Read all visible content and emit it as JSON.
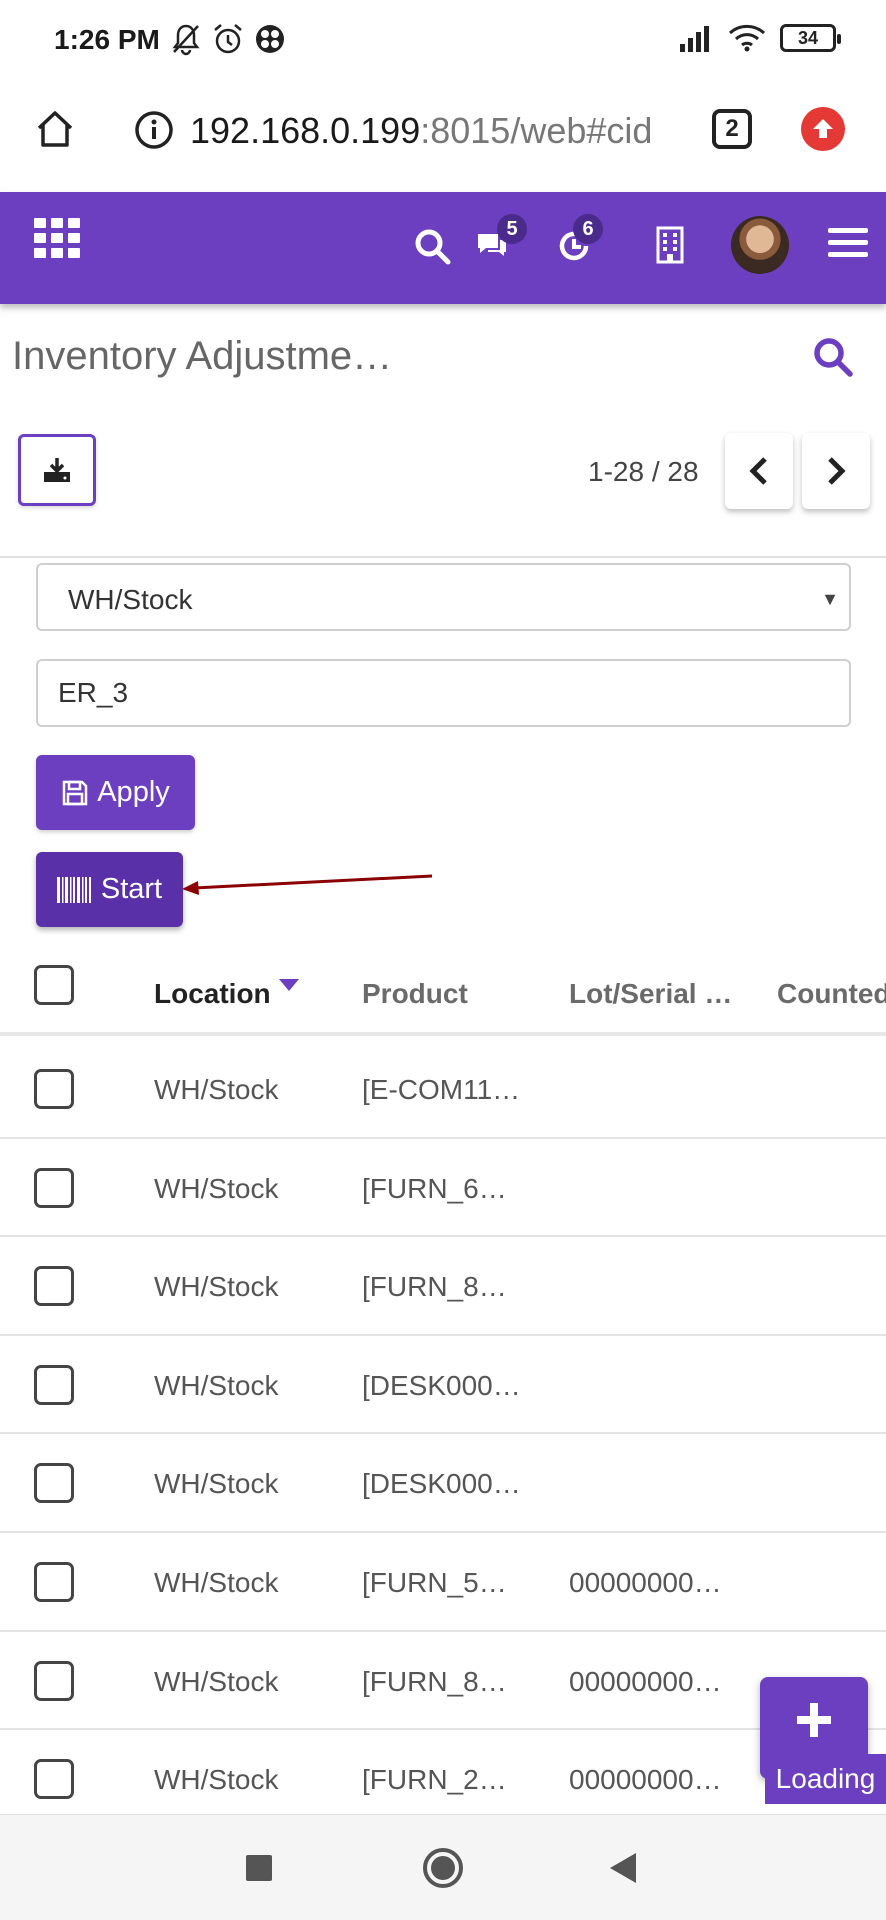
{
  "status_bar": {
    "time": "1:26 PM",
    "battery": "34"
  },
  "browser": {
    "url_host": "192.168.0.199",
    "url_rest": ":8015/web#cid",
    "tab_count": "2"
  },
  "navbar": {
    "chat_badge": "5",
    "activity_badge": "6"
  },
  "control_panel": {
    "title": "Inventory Adjustme…",
    "pager": "1-28 / 28"
  },
  "filters": {
    "location_value": "WH/Stock",
    "lot_value": "ER_3",
    "apply_label": "Apply",
    "start_label": "Start"
  },
  "table": {
    "columns": {
      "location": "Location",
      "product": "Product",
      "lot": "Lot/Serial …",
      "counted": "Counted"
    },
    "rows": [
      {
        "location": "WH/Stock",
        "product": "[E-COM11…",
        "lot": ""
      },
      {
        "location": "WH/Stock",
        "product": "[FURN_6…",
        "lot": ""
      },
      {
        "location": "WH/Stock",
        "product": "[FURN_8…",
        "lot": ""
      },
      {
        "location": "WH/Stock",
        "product": "[DESK000…",
        "lot": ""
      },
      {
        "location": "WH/Stock",
        "product": "[DESK000…",
        "lot": ""
      },
      {
        "location": "WH/Stock",
        "product": "[FURN_5…",
        "lot": "00000000…"
      },
      {
        "location": "WH/Stock",
        "product": "[FURN_8…",
        "lot": "00000000…"
      },
      {
        "location": "WH/Stock",
        "product": "[FURN_2…",
        "lot": "00000000…"
      }
    ]
  },
  "loading_label": "Loading",
  "colors": {
    "brand": "#6b3fbf",
    "start_button": "#5a30a8",
    "annotation_arrow": "#8b0000"
  }
}
